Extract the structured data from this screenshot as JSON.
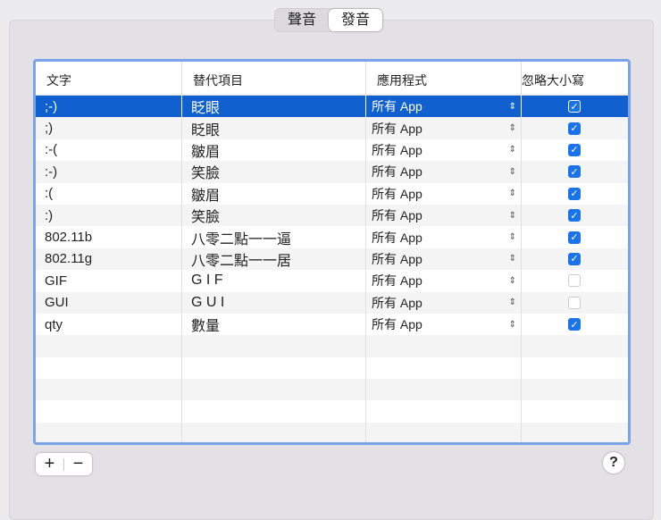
{
  "tabs": [
    {
      "label": "聲音",
      "active": false
    },
    {
      "label": "發音",
      "active": true
    }
  ],
  "columns": [
    "文字",
    "替代項目",
    "應用程式",
    "忽略大小寫"
  ],
  "rows": [
    {
      "text": ";-)",
      "replacement": "眨眼",
      "app": "所有 App",
      "ignore_case": true,
      "selected": true
    },
    {
      "text": ";)",
      "replacement": "眨眼",
      "app": "所有 App",
      "ignore_case": true
    },
    {
      "text": ":-(",
      "replacement": "皺眉",
      "app": "所有 App",
      "ignore_case": true
    },
    {
      "text": ":-)",
      "replacement": "笑臉",
      "app": "所有 App",
      "ignore_case": true
    },
    {
      "text": ":(",
      "replacement": "皺眉",
      "app": "所有 App",
      "ignore_case": true
    },
    {
      "text": ":)",
      "replacement": "笑臉",
      "app": "所有 App",
      "ignore_case": true
    },
    {
      "text": "802.11b",
      "replacement": "八零二點一一逼",
      "app": "所有 App",
      "ignore_case": true
    },
    {
      "text": "802.11g",
      "replacement": "八零二點一一居",
      "app": "所有 App",
      "ignore_case": true
    },
    {
      "text": "GIF",
      "replacement": "G I F",
      "app": "所有 App",
      "ignore_case": false
    },
    {
      "text": "GUI",
      "replacement": "G U I",
      "app": "所有 App",
      "ignore_case": false
    },
    {
      "text": "qty",
      "replacement": "數量",
      "app": "所有 App",
      "ignore_case": true
    }
  ],
  "buttons": {
    "add": "+",
    "remove": "−",
    "help": "?"
  }
}
